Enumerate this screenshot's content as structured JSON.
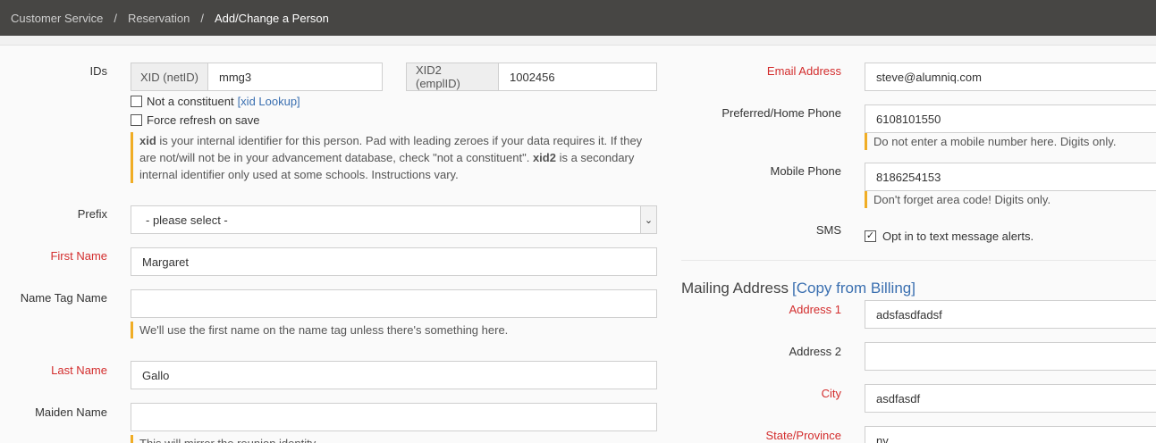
{
  "breadcrumb": {
    "items": [
      "Customer Service",
      "Reservation",
      "Add/Change a Person"
    ],
    "separator": "/"
  },
  "ids": {
    "label": "IDs",
    "xid_addon": "XID (netID)",
    "xid_value": "mmg3",
    "xid2_addon": "XID2 (emplID)",
    "xid2_value": "1002456",
    "not_constituent_label": "Not a constituent",
    "xid_lookup_link": "[xid Lookup]",
    "force_refresh_label": "Force refresh on save",
    "help": {
      "b1": "xid",
      "t1": " is your internal identifier for this person. Pad with leading zeroes if your data requires it. If they are not/will not be in your advancement database, check \"not a constituent\". ",
      "b2": "xid2",
      "t2": " is a secondary internal identifier only used at some schools. Instructions vary."
    }
  },
  "prefix": {
    "label": "Prefix",
    "selected": "- please select -"
  },
  "first_name": {
    "label": "First Name",
    "value": "Margaret"
  },
  "name_tag": {
    "label": "Name Tag Name",
    "value": "",
    "help": "We'll use the first name on the name tag unless there's something here."
  },
  "last_name": {
    "label": "Last Name",
    "value": "Gallo"
  },
  "maiden_name": {
    "label": "Maiden Name",
    "value": "",
    "help": "This will mirror the reunion identity."
  },
  "email": {
    "label": "Email Address",
    "value": "steve@alumniq.com"
  },
  "home_phone": {
    "label": "Preferred/Home Phone",
    "value": "6108101550",
    "help": "Do not enter a mobile number here. Digits only."
  },
  "mobile_phone": {
    "label": "Mobile Phone",
    "value": "8186254153",
    "help": "Don't forget area code! Digits only."
  },
  "sms": {
    "label": "SMS",
    "option": "Opt in to text message alerts.",
    "checked": true
  },
  "mailing": {
    "heading": "Mailing Address",
    "copy_link": "[Copy from Billing]",
    "address1": {
      "label": "Address 1",
      "value": "adsfasdfadsf"
    },
    "address2": {
      "label": "Address 2",
      "value": ""
    },
    "city": {
      "label": "City",
      "value": "asdfasdf"
    },
    "state": {
      "label": "State/Province",
      "value": "ny"
    }
  },
  "colors": {
    "topbar": "#474644",
    "required_label": "#d32d2d",
    "link": "#3a6fb0",
    "help_accent": "#f0ad25"
  }
}
